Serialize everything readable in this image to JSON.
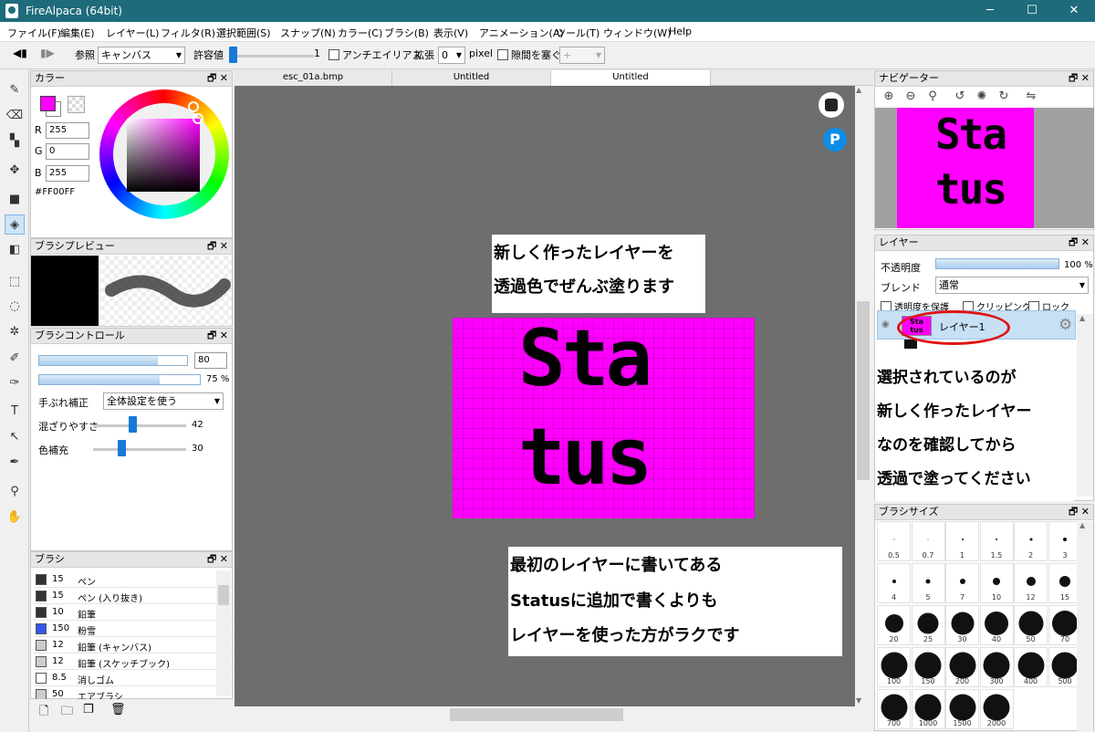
{
  "window": {
    "title": "FireAlpaca (64bit)",
    "minimize": "─",
    "maximize": "☐",
    "close": "✕"
  },
  "menu": [
    "ファイル(F)",
    "編集(E)",
    "レイヤー(L)",
    "フィルタ(R)",
    "選択範囲(S)",
    "スナップ(N)",
    "カラー(C)",
    "ブラシ(B)",
    "表示(V)",
    "アニメーション(A)",
    "ツール(T)",
    "ウィンドウ(W)",
    "Help"
  ],
  "toolbar": {
    "ref_label": "参照",
    "ref_value": "キャンバス",
    "tolerance_label": "許容値",
    "tolerance_value": "1",
    "antialias_label": "アンチエイリアス",
    "expand_label": "拡張",
    "expand_value": "0",
    "expand_unit": "pixel",
    "gap_label": "隙間を塞ぐ",
    "gap_value": "+"
  },
  "tools": [
    "pen-icon",
    "eraser-icon",
    "dot-icon",
    "move-icon",
    "fill-rect-icon",
    "bucket-icon",
    "gradient-icon",
    "select-rect-icon",
    "lasso-icon",
    "magic-wand-icon",
    "select-pen-icon",
    "select-eraser-icon",
    "text-icon",
    "operation-icon",
    "dropper-pen-icon",
    "eyedropper-icon",
    "hand-icon"
  ],
  "color_panel": {
    "title": "カラー",
    "r_label": "R",
    "r": "255",
    "g_label": "G",
    "g": "0",
    "b_label": "B",
    "b": "255",
    "hex": "#FF00FF",
    "fg_color": "#ff00ff"
  },
  "brush_preview": {
    "title": "ブラシプレビュー"
  },
  "brush_control": {
    "title": "ブラシコントロール",
    "size_value": "80",
    "size_level": 0.8,
    "opacity_value": "75 %",
    "opacity_level": 0.75,
    "stabilizer_label": "手ぶれ補正",
    "stabilizer_value": "全体設定を使う",
    "mix_label": "混ざりやすさ",
    "mix_value": "42",
    "mix_level": 0.42,
    "color_fill_label": "色補充",
    "color_fill_value": "30",
    "color_fill_level": 0.3
  },
  "brush_list": {
    "title": "ブラシ",
    "items": [
      {
        "size": "15",
        "name": "ペン",
        "color": "#333333"
      },
      {
        "size": "15",
        "name": "ペン (入り抜き)",
        "color": "#333333"
      },
      {
        "size": "10",
        "name": "鉛筆",
        "color": "#333333"
      },
      {
        "size": "150",
        "name": "粉雪",
        "color": "#3355ee"
      },
      {
        "size": "12",
        "name": "鉛筆 (キャンバス)",
        "color": "#cccccc"
      },
      {
        "size": "12",
        "name": "鉛筆 (スケッチブック)",
        "color": "#cccccc"
      },
      {
        "size": "8.5",
        "name": "消しゴム",
        "color": "#ffffff"
      },
      {
        "size": "50",
        "name": "エアブラシ",
        "color": "#cccccc"
      }
    ]
  },
  "tabs": [
    {
      "label": "esc_01a.bmp"
    },
    {
      "label": "Untitled"
    },
    {
      "label": "Untitled"
    }
  ],
  "canvas": {
    "art_line1": "Sta",
    "art_line2": "tus",
    "note_top": [
      "新しく作ったレイヤーを",
      "透過色でぜんぶ塗ります"
    ],
    "note_bottom": [
      "最初のレイヤーに書いてある",
      "Statusに追加で書くよりも",
      "レイヤーを使った方がラクです"
    ],
    "magenta": "#ff00ff"
  },
  "navigator": {
    "title": "ナビゲーター"
  },
  "layers": {
    "title": "レイヤー",
    "opacity_label": "不透明度",
    "opacity_value": "100 %",
    "opacity_level": 1.0,
    "blend_label": "ブレンド",
    "blend_value": "通常",
    "protect_label": "透明度を保護",
    "clipping_label": "クリッピング",
    "lock_label": "ロック",
    "layer_name": "レイヤー1",
    "thumb_line1": "Sta",
    "thumb_line2": "tus",
    "note": [
      "選択されているのが",
      "新しく作ったレイヤー",
      "なのを確認してから",
      "透過で塗ってください"
    ]
  },
  "brush_sizes": {
    "title": "ブラシサイズ",
    "values": [
      "0.5",
      "0.7",
      "1",
      "1.5",
      "2",
      "3",
      "4",
      "5",
      "7",
      "10",
      "12",
      "15",
      "20",
      "25",
      "30",
      "40",
      "50",
      "70",
      "100",
      "150",
      "200",
      "300",
      "400",
      "500",
      "700",
      "1000",
      "1500",
      "2000"
    ]
  }
}
